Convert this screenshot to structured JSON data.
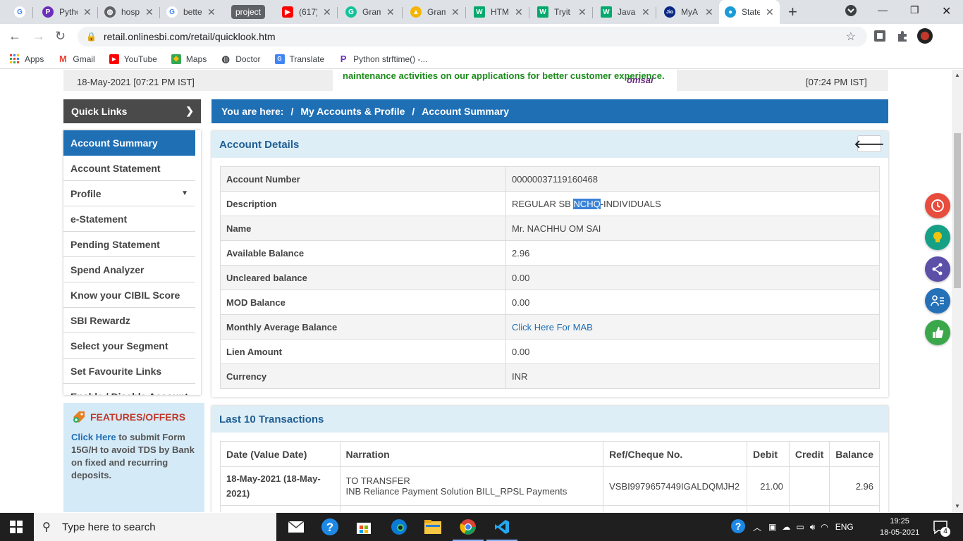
{
  "browser": {
    "tabs": [
      {
        "label": "G",
        "title": "",
        "color": "#4285f4",
        "icon": "google-icon"
      },
      {
        "label": "P",
        "title": "Pytho",
        "color": "#6b2fbb",
        "icon": "python-icon"
      },
      {
        "label": "◍",
        "title": "hosp",
        "color": "#5f6368",
        "icon": "globe-icon"
      },
      {
        "label": "G",
        "title": "bette",
        "color": "#4285f4",
        "icon": "google-icon"
      },
      {
        "label": "▶",
        "title": "(617)",
        "color": "#ff0000",
        "icon": "youtube-icon"
      },
      {
        "label": "G",
        "title": "Gram",
        "color": "#15c39a",
        "icon": "grammarly-icon"
      },
      {
        "label": "▲",
        "title": "Gram",
        "color": "#f4b400",
        "icon": "drive-icon"
      },
      {
        "label": "W",
        "title": "HTM",
        "color": "#04aa6d",
        "icon": "w3schools-icon"
      },
      {
        "label": "W",
        "title": "Tryit",
        "color": "#04aa6d",
        "icon": "w3schools-icon"
      },
      {
        "label": "W",
        "title": "Java",
        "color": "#04aa6d",
        "icon": "w3schools-icon"
      },
      {
        "label": "Jio",
        "title": "MyA",
        "color": "#0a2885",
        "icon": "jio-icon"
      },
      {
        "label": "●",
        "title": "State",
        "color": "#1a9bd7",
        "icon": "sbi-icon"
      }
    ],
    "group_label": "project",
    "url": "retail.onlinesbi.com/retail/quicklook.htm",
    "bookmarks": [
      {
        "label": "Apps",
        "icon": "apps-grid-icon"
      },
      {
        "label": "Gmail",
        "icon": "gmail-icon"
      },
      {
        "label": "YouTube",
        "icon": "youtube-icon"
      },
      {
        "label": "Maps",
        "icon": "maps-icon"
      },
      {
        "label": "Doctor",
        "icon": "globe-icon"
      },
      {
        "label": "Translate",
        "icon": "translate-icon"
      },
      {
        "label": "Python strftime() -...",
        "icon": "python-icon"
      }
    ]
  },
  "header": {
    "last_login": "18-May-2021 [07:21 PM IST]",
    "notice": "naintenance activities on our applications for better customer experience.",
    "user": "omsai",
    "current_time": "[07:24 PM IST]"
  },
  "quick_links": {
    "title": "Quick Links",
    "items": [
      "Account Summary",
      "Account Statement",
      "Profile",
      "e-Statement",
      "Pending Statement",
      "Spend Analyzer",
      "Know your CIBIL Score",
      "SBI Rewardz",
      "Select your Segment",
      "Set Favourite Links",
      "Enable / Disable Account"
    ]
  },
  "breadcrumb": {
    "prefix": "You are here:",
    "sep": "/",
    "level1": "My Accounts & Profile",
    "level2": "Account Summary"
  },
  "features": {
    "title": "FEATURES/OFFERS",
    "link": "Click Here",
    "text": " to submit Form 15G/H to avoid TDS by Bank on fixed and recurring deposits."
  },
  "account_details": {
    "title": "Account Details",
    "rows": [
      {
        "label": "Account Number",
        "value": "00000037119160468"
      },
      {
        "label": "Description",
        "value_pre": "REGULAR SB ",
        "value_hl": "NCHQ",
        "value_post": "-INDIVIDUALS"
      },
      {
        "label": "Name",
        "value": "Mr. NACHHU OM SAI"
      },
      {
        "label": "Available Balance",
        "value": "2.96"
      },
      {
        "label": "Uncleared balance",
        "value": "0.00"
      },
      {
        "label": "MOD Balance",
        "value": "0.00"
      },
      {
        "label": "Monthly Average Balance",
        "value": "Click Here For MAB"
      },
      {
        "label": "Lien Amount",
        "value": "0.00"
      },
      {
        "label": "Currency",
        "value": "INR"
      }
    ]
  },
  "transactions": {
    "title": "Last 10 Transactions",
    "headers": [
      "Date (Value Date)",
      "Narration",
      "Ref/Cheque No.",
      "Debit",
      "Credit",
      "Balance"
    ],
    "rows": [
      {
        "date": "18-May-2021 (18-May-2021)",
        "narration_1": "TO TRANSFER",
        "narration_2": "INB Reliance Payment Solution BILL_RPSL Payments",
        "ref": "VSBI9979657449IGALDQMJH2",
        "debit": "21.00",
        "credit": "",
        "balance": "2.96"
      }
    ]
  },
  "taskbar": {
    "search_placeholder": "Type here to search",
    "language": "ENG",
    "time": "19:25",
    "date": "18-05-2021",
    "notifications": "4"
  },
  "colors": {
    "sbi_blue": "#1f6fb5",
    "panel_header": "#deeef6",
    "quick_links_dark": "#4a4a4a"
  }
}
